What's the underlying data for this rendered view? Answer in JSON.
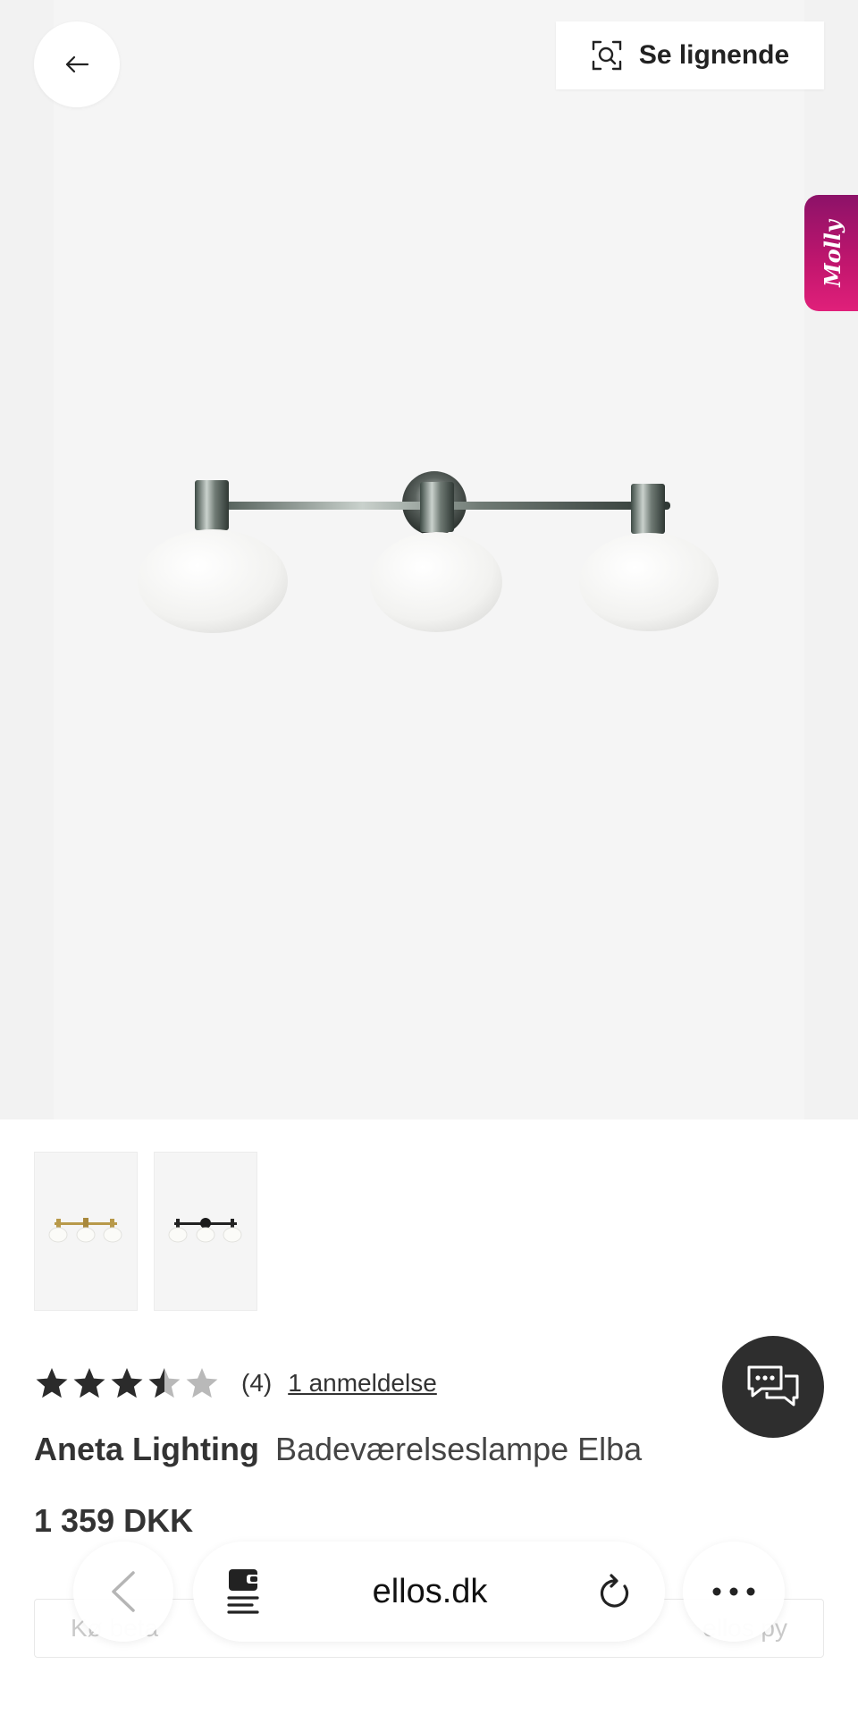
{
  "header": {
    "similar_label": "Se lignende",
    "molly_label": "Molly"
  },
  "icons": {
    "back": "arrow-left-icon",
    "similar": "visual-search-icon",
    "chat": "chat-bubbles-icon",
    "star": "star-icon",
    "nav_back": "chevron-left-icon",
    "reader": "reader-mode-icon",
    "reload": "reload-icon",
    "more": "ellipsis-icon"
  },
  "product": {
    "rating": 3.5,
    "rating_max": 5,
    "rating_count": "(4)",
    "review_link": "1 anmeldelse",
    "brand": "Aneta Lighting",
    "name": "Badeværelseslampe Elba",
    "price": "1 359 DKK"
  },
  "payment_strip": {
    "left_text": "Kø     beta          ",
    "right_text": "ellos    py"
  },
  "browser": {
    "url": "ellos.dk"
  },
  "colors": {
    "molly_gradient_start": "#8c1268",
    "molly_gradient_end": "#e0207a",
    "chat_button": "#2e2e2e",
    "star_filled": "#2b2b2b",
    "star_empty": "#b9b9b9"
  }
}
